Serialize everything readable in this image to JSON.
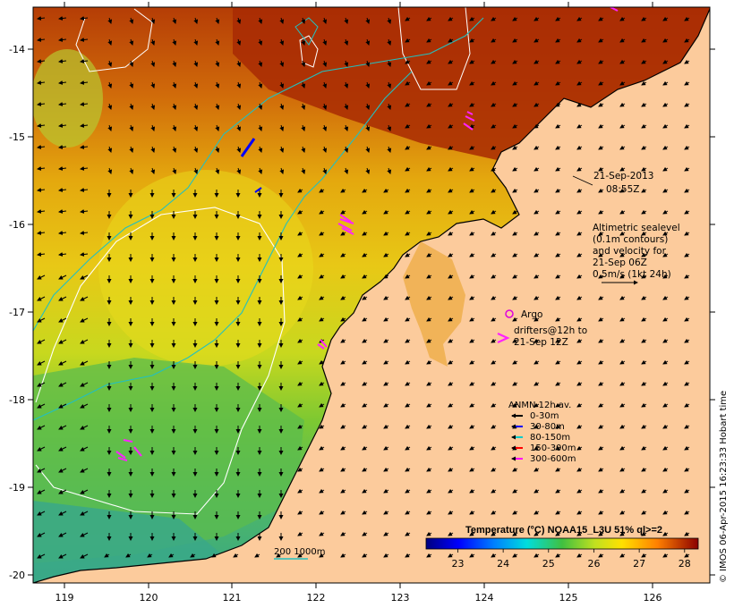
{
  "map": {
    "date_label": "21-Sep-2013",
    "time_label": "08:55Z",
    "altimetry_lines": [
      "Altimetric sealevel",
      "(0.1m contours)",
      "and velocity for",
      "21-Sep 06Z",
      "0.5m/s (1kt 24h)"
    ],
    "argo_label": "Argo",
    "drifters_lines": [
      "drifters@12h to",
      "21-Sep 12Z"
    ],
    "anmn_title": "ANMN 12h av.",
    "anmn_items": [
      {
        "label": "0-30m",
        "color": "#000000"
      },
      {
        "label": "30-80m",
        "color": "#0000ff"
      },
      {
        "label": "80-150m",
        "color": "#00cccc"
      },
      {
        "label": "150-300m",
        "color": "#ff0000"
      },
      {
        "label": "300-600m",
        "color": "#ff00ff"
      }
    ],
    "bathy_label": "200  1000m",
    "credit": "© IMOS 06-Apr-2015 16:23:33 Hobart time",
    "x_ticks": [
      "119",
      "120",
      "121",
      "122",
      "123",
      "124",
      "125",
      "126"
    ],
    "y_ticks": [
      "-14",
      "-15",
      "-16",
      "-17",
      "-18",
      "-19",
      "-20"
    ],
    "colorbar": {
      "title": "Temperature (°C) NOAA15_L3U 51% ql>=2",
      "ticks": [
        "23",
        "24",
        "25",
        "26",
        "27",
        "28"
      ],
      "min": 22.3,
      "max": 28.3
    },
    "colors": {
      "land": "#fccb9c",
      "argo": "#dd00dd",
      "drifter": "#ff22ff"
    }
  }
}
